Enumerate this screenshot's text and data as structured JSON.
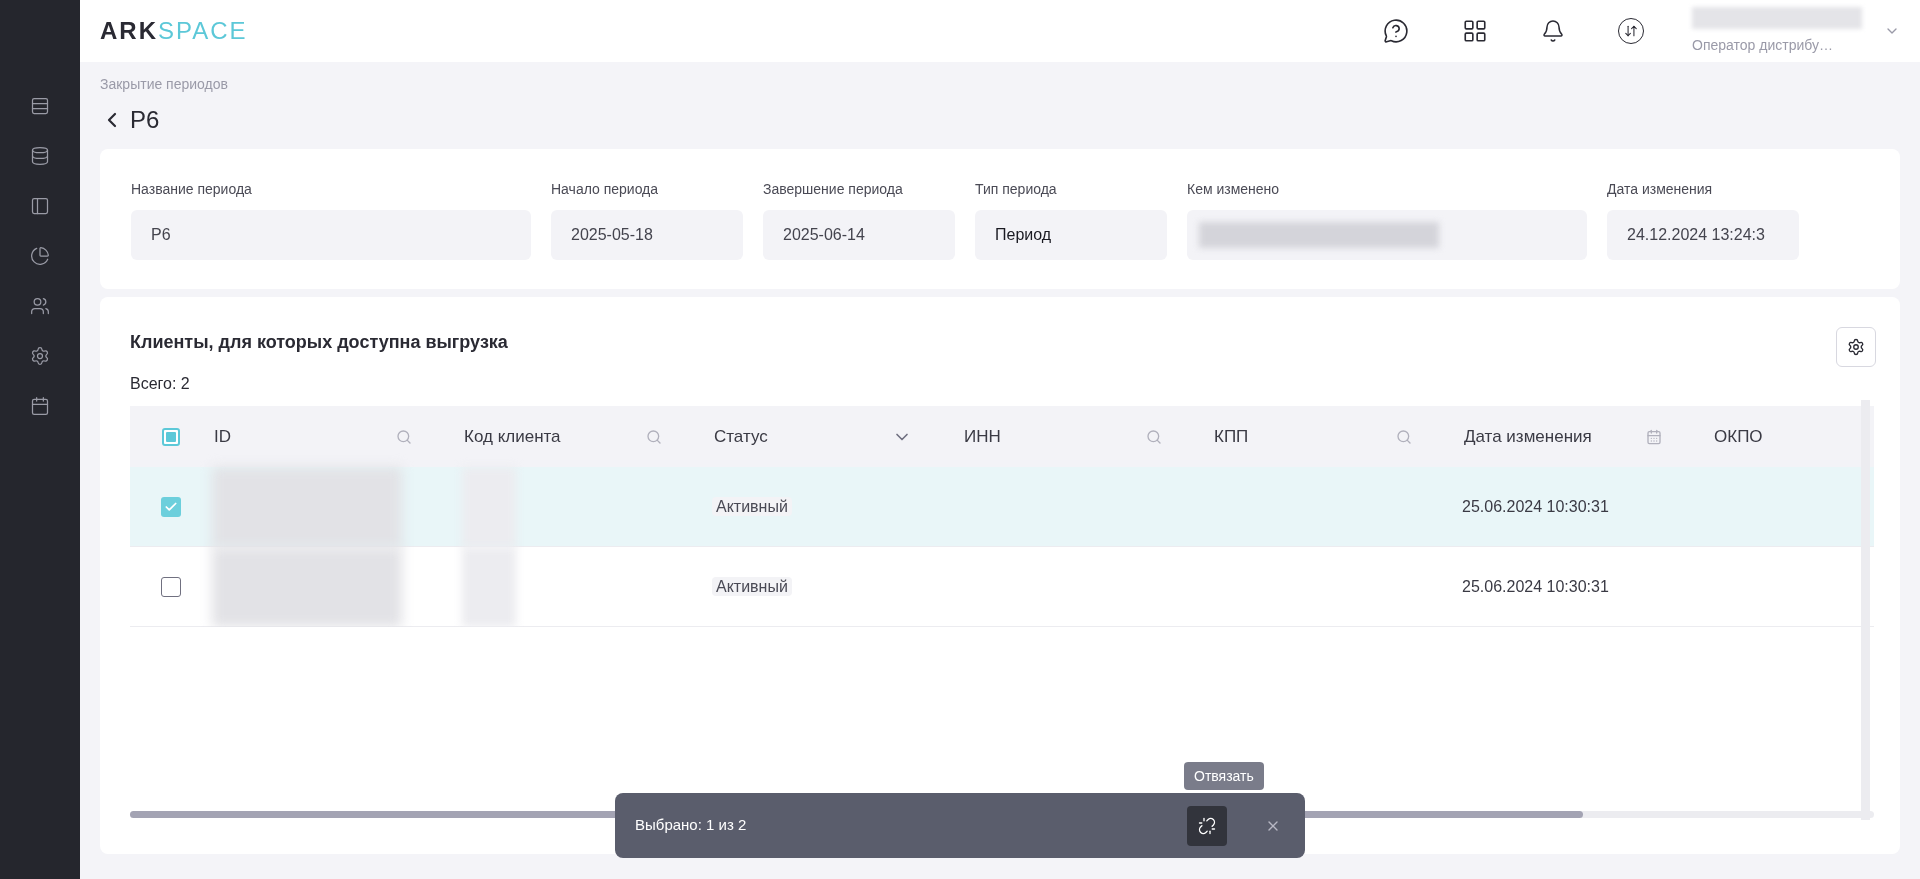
{
  "logo": {
    "part_1": "ARK",
    "part_2": "SPACE"
  },
  "user": {
    "role": "Оператор дистрибу…"
  },
  "breadcrumb": "Закрытие периодов",
  "title": "Р6",
  "period_fields": [
    {
      "label": "Название периода",
      "value": "Р6",
      "wide": true,
      "kind": "text"
    },
    {
      "label": "Начало периода",
      "value": "2025-05-18",
      "wide": false,
      "kind": "text"
    },
    {
      "label": "Завершение периода",
      "value": "2025-06-14",
      "wide": false,
      "kind": "text"
    },
    {
      "label": "Тип периода",
      "value": "Период",
      "wide": false,
      "kind": "select"
    },
    {
      "label": "Кем изменено",
      "wide": true,
      "kind": "blurred"
    },
    {
      "label": "Дата изменения",
      "value": "24.12.2024 13:24:3",
      "wide": false,
      "kind": "text"
    }
  ],
  "clients": {
    "title": "Клиенты, для которых доступна выгрузка",
    "total": "Всего: 2",
    "select_all_partial": true,
    "columns": [
      {
        "label": "ID",
        "kind": "search"
      },
      {
        "label": "Код клиента",
        "kind": "search"
      },
      {
        "label": "Статус",
        "kind": "select"
      },
      {
        "label": "ИНН",
        "kind": "search"
      },
      {
        "label": "КПП",
        "kind": "search"
      },
      {
        "label": "Дата изменения",
        "kind": "date"
      },
      {
        "label": "ОКПО",
        "kind": "plain"
      }
    ],
    "rows": [
      {
        "selected": true,
        "status": "Активный",
        "changed": "25.06.2024 10:30:31"
      },
      {
        "selected": false,
        "status": "Активный",
        "changed": "25.06.2024 10:30:31"
      }
    ]
  },
  "selection_bar": {
    "text": "Выбрано: 1 из 2",
    "tooltip": "Отвязать"
  }
}
